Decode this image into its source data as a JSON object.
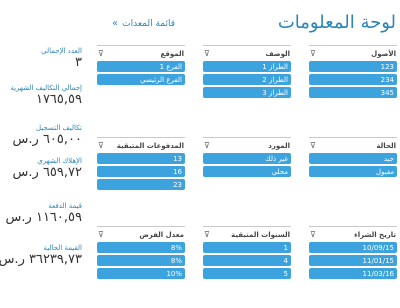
{
  "page": {
    "title": "لوحة المعلومات",
    "breadcrumb": "قائمة المعدات",
    "breadcrumb_icon": "double-chevron-icon"
  },
  "kpis": [
    {
      "label": "العدد الإجمالي",
      "value": "٣"
    },
    {
      "label": "إجمالي التكاليف الشهرية",
      "value": "١٧٦٥,٥٩"
    },
    {
      "label": "تكاليف التسجيل",
      "value": "٦٠٥,٠٠ ر.س"
    },
    {
      "label": "الإهلاك الشهري",
      "value": "٦٥٩,٧٢ ر.س"
    },
    {
      "label": "قيمة الدفعة",
      "value": "١١٦٠,٥٩ ر.س"
    },
    {
      "label": "القيمة الحالية",
      "value": "٣٦٢٣٩,٧٣ ر.س"
    }
  ],
  "panels": {
    "asset": {
      "label": "الأصول",
      "items": [
        "123",
        "234",
        "345"
      ]
    },
    "description": {
      "label": "الوصف",
      "items": [
        "الطراز 1",
        "الطراز 2",
        "الطراز 3"
      ]
    },
    "location": {
      "label": "الموقع",
      "items": [
        "الفرع 1",
        "الفرع الرئيسي"
      ]
    },
    "status": {
      "label": "الحالة",
      "items": [
        "جيد",
        "مقبول"
      ]
    },
    "vendor": {
      "label": "المورد",
      "items": [
        "غير ذلك",
        "محلي"
      ]
    },
    "remaining_payments": {
      "label": "المدفوعات المتبقية",
      "items": [
        "13",
        "16",
        "23"
      ]
    },
    "purchase_date": {
      "label": "تاريخ الشراء",
      "items": [
        "10/09/15",
        "11/01/15",
        "11/03/16"
      ]
    },
    "remaining_years": {
      "label": "السنوات المتبقية",
      "items": [
        "1",
        "4",
        "5"
      ]
    },
    "interest_rate": {
      "label": "معدل الفرض",
      "items": [
        "8%",
        "8%",
        "10%"
      ]
    }
  },
  "colors": {
    "accent": "#2a86b9",
    "tile": "#3ca3de"
  },
  "filter_icon": "filter-icon"
}
